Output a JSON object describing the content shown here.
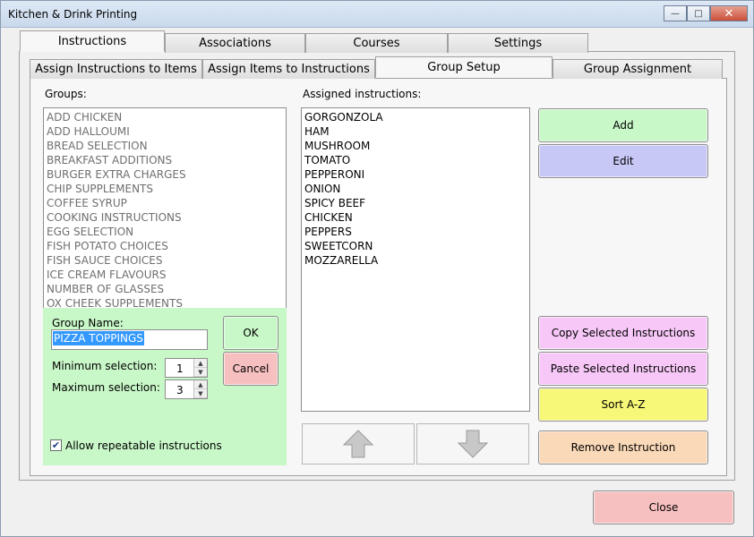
{
  "window": {
    "title": "Kitchen & Drink Printing"
  },
  "main_tabs": [
    "Instructions",
    "Associations",
    "Courses",
    "Settings"
  ],
  "sub_tabs": [
    "Assign Instructions to Items",
    "Assign Items to Instructions",
    "Group Setup",
    "Group Assignment"
  ],
  "groups": {
    "label": "Groups:",
    "items": [
      "ADD CHICKEN",
      "ADD HALLOUMI",
      "BREAD SELECTION",
      "BREAKFAST ADDITIONS",
      "BURGER EXTRA CHARGES",
      "CHIP SUPPLEMENTS",
      "COFFEE SYRUP",
      "COOKING INSTRUCTIONS",
      "EGG SELECTION",
      "FISH POTATO CHOICES",
      "FISH SAUCE CHOICES",
      "ICE CREAM FLAVOURS",
      "NUMBER OF GLASSES",
      "OX CHEEK SUPPLEMENTS"
    ]
  },
  "assigned": {
    "label": "Assigned instructions:",
    "items": [
      "GORGONZOLA",
      "HAM",
      "MUSHROOM",
      "TOMATO",
      "PEPPERONI",
      "ONION",
      "SPICY BEEF",
      "CHICKEN",
      "PEPPERS",
      "SWEETCORN",
      "MOZZARELLA"
    ]
  },
  "group_form": {
    "name_label": "Group Name:",
    "name_value": "PIZZA TOPPINGS",
    "min_label": "Minimum selection:",
    "min_value": "1",
    "max_label": "Maximum selection:",
    "max_value": "3",
    "ok_label": "OK",
    "cancel_label": "Cancel",
    "repeatable_label": "Allow repeatable instructions",
    "repeatable_checked": true
  },
  "actions": {
    "add": "Add",
    "edit": "Edit",
    "copy": "Copy Selected Instructions",
    "paste": "Paste Selected Instructions",
    "sort": "Sort A-Z",
    "remove": "Remove Instruction",
    "close": "Close"
  },
  "colors": {
    "add": "#c8f7c8",
    "edit": "#c8c8f7",
    "copy": "#f7c8f7",
    "paste": "#f7c8f7",
    "sort": "#f7f778",
    "remove": "#fad9b8",
    "ok": "#c8f7c8",
    "cancel": "#f7c0c0",
    "close": "#f7c0c0",
    "panel": "#c8f7c8"
  }
}
